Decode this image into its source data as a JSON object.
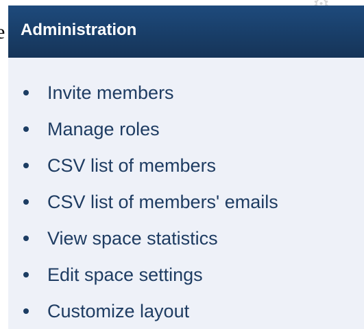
{
  "left_edge_text": "e",
  "panel": {
    "title": "Administration",
    "items": [
      {
        "label": "Invite members"
      },
      {
        "label": "Manage roles"
      },
      {
        "label": "CSV list of members"
      },
      {
        "label": "CSV list of members' emails"
      },
      {
        "label": "View space statistics"
      },
      {
        "label": "Edit space settings"
      },
      {
        "label": "Customize layout"
      }
    ]
  },
  "icons": {
    "top_fragment": "gear-icon"
  },
  "colors": {
    "header_dark": "#163458",
    "header_light": "#1e4a7c",
    "panel_background": "#eef1f8",
    "link_text": "#1e3c62",
    "bullet": "#1c3d63"
  }
}
